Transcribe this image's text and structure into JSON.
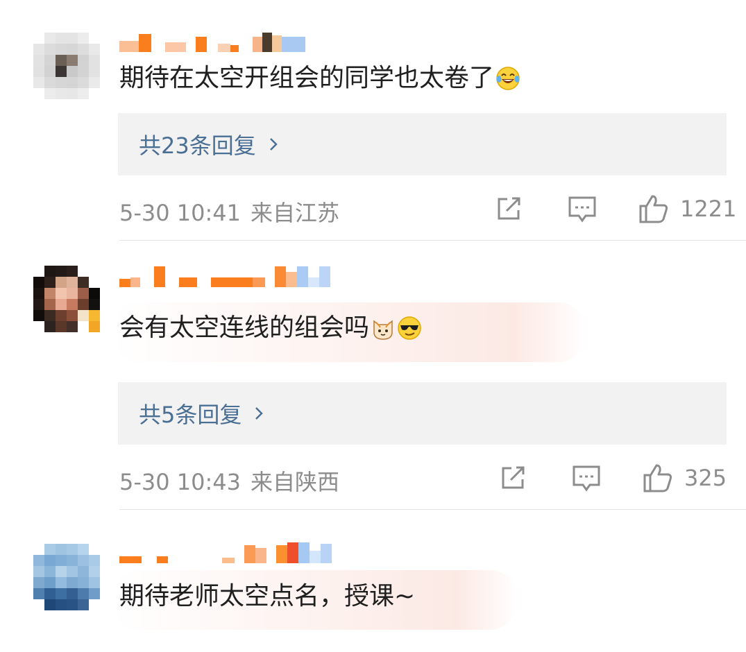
{
  "comments": [
    {
      "text": "期待在太空开组会的同学也太卷了",
      "emojis": [
        "laughing-tears-emoji"
      ],
      "replies_label": "共23条回复",
      "date": "5-30 10:41",
      "location": "来自江苏",
      "likes": "1221"
    },
    {
      "text": "会有太空连线的组会吗",
      "emojis": [
        "cat-emoji",
        "sunglasses-emoji"
      ],
      "replies_label": "共5条回复",
      "date": "5-30 10:43",
      "location": "来自陕西",
      "likes": "325"
    },
    {
      "text": "期待老师太空点名，授课~",
      "emojis": []
    }
  ],
  "colors": {
    "username_orange": "#fa7d1e",
    "reply_link": "#4a6f95",
    "meta_gray": "#8c8c8c",
    "reply_box_bg": "#f2f2f2"
  },
  "icons": [
    "share-icon",
    "comment-icon",
    "like-icon",
    "chevron-right-icon"
  ]
}
